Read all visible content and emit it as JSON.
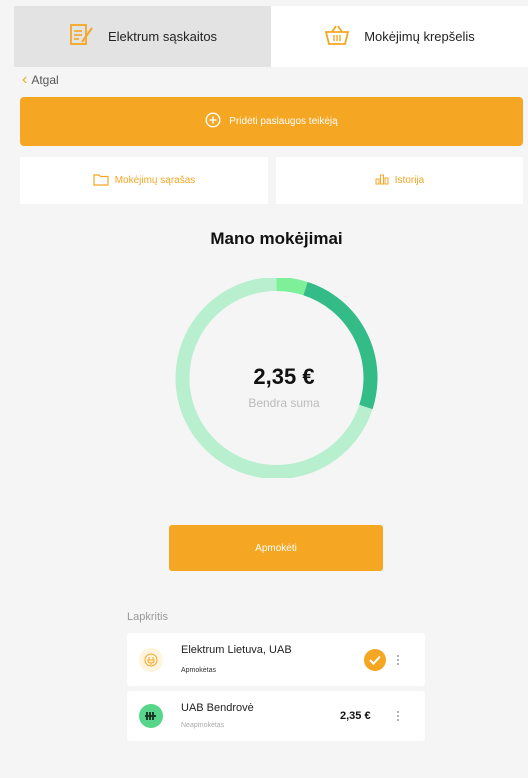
{
  "tabs": [
    {
      "label": "Elektrum sąskaitos",
      "icon": "invoice-edit-icon",
      "active": true
    },
    {
      "label": "Mokėjimų krepšelis",
      "icon": "basket-icon",
      "active": false
    }
  ],
  "back_label": "Atgal",
  "add_provider_label": "Pridėti paslaugos teikėją",
  "subtabs": {
    "list_label": "Mokėjimų sąrašas",
    "history_label": "Istorija"
  },
  "title": "Mano mokėjimai",
  "donut": {
    "amount": "2,35 €",
    "amount_label": "Bendra suma",
    "segments": [
      {
        "fraction": 0.05,
        "color": "#7ef09a"
      },
      {
        "fraction": 0.25,
        "color": "#33bb88"
      },
      {
        "fraction": 0.7,
        "color": "#b8f0cf"
      }
    ]
  },
  "pay_label": "Apmokėti",
  "month": "Lapkritis",
  "items": [
    {
      "name": "Elektrum Lietuva, UAB",
      "status": "Apmokėtas",
      "price": "",
      "icon": "electric-plug-icon",
      "paid": true
    },
    {
      "name": "UAB Bendrovė",
      "status": "Neapmokėtas",
      "price": "2,35 €",
      "icon": "radiator-icon",
      "paid": false
    }
  ],
  "colors": {
    "accent": "#f5a623",
    "background": "#f5f5f5",
    "paid_icon_bg": "#fff4e0",
    "unpaid_icon_bg": "#55d68a"
  }
}
